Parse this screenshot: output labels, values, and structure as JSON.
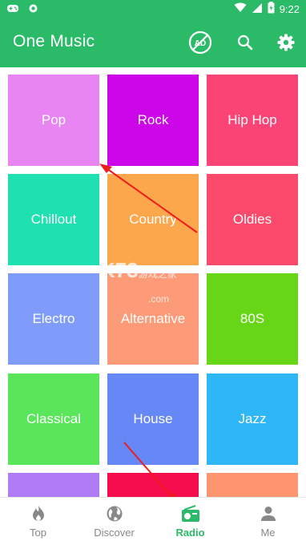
{
  "status": {
    "time": "9:22"
  },
  "app": {
    "title": "One Music",
    "accent": "#2aba68"
  },
  "genres": [
    {
      "label": "Pop",
      "color": "#e985f3"
    },
    {
      "label": "Rock",
      "color": "#cc06e8"
    },
    {
      "label": "Hip Hop",
      "color": "#fb4476"
    },
    {
      "label": "Chillout",
      "color": "#1ee0b0"
    },
    {
      "label": "Country",
      "color": "#fda74d"
    },
    {
      "label": "Oldies",
      "color": "#fb4a6c"
    },
    {
      "label": "Electro",
      "color": "#7f9cfb"
    },
    {
      "label": "Alternative",
      "color": "#fd9b78"
    },
    {
      "label": "80S",
      "color": "#66d617"
    },
    {
      "label": "Classical",
      "color": "#5ae65a"
    },
    {
      "label": "House",
      "color": "#6687f6"
    },
    {
      "label": "Jazz",
      "color": "#2fb6f7"
    },
    {
      "label": "",
      "color": "#b07cf5"
    },
    {
      "label": "",
      "color": "#f50c4a"
    },
    {
      "label": "",
      "color": "#fd9670"
    }
  ],
  "nav": [
    {
      "label": "Top",
      "icon": "flame-icon"
    },
    {
      "label": "Discover",
      "icon": "globe-icon"
    },
    {
      "label": "Radio",
      "icon": "radio-icon",
      "active": true
    },
    {
      "label": "Me",
      "icon": "person-icon"
    }
  ],
  "watermark": {
    "main": "K73",
    "sub": "游戏之家",
    "domain": ".com"
  }
}
